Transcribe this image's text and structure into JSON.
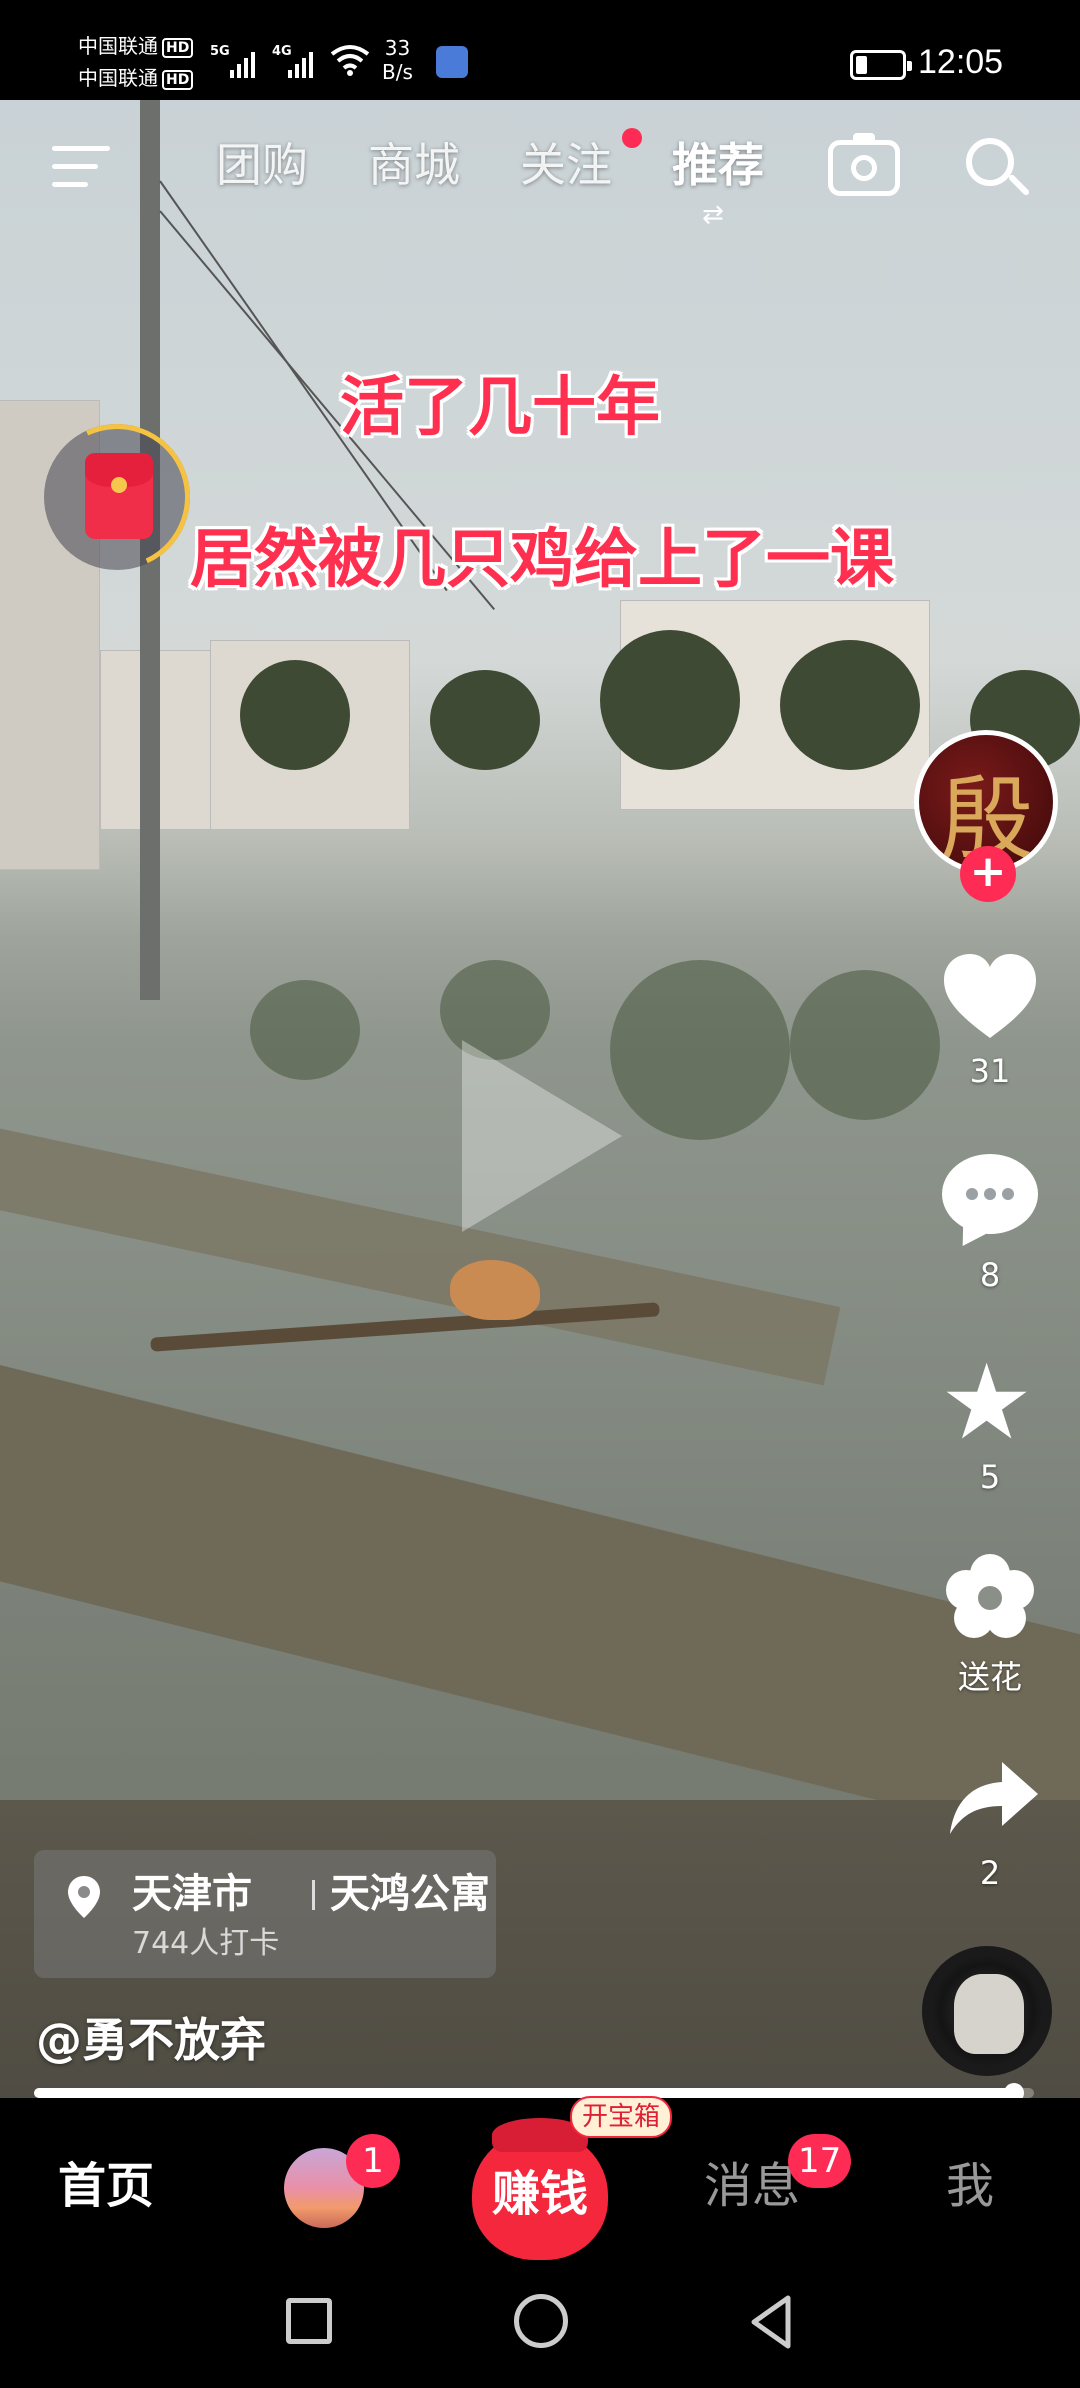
{
  "status_bar": {
    "carrier1": "中国联通",
    "carrier2": "中国联通",
    "hd": "HD",
    "net1": "5G",
    "net2": "4G",
    "speed_value": "33",
    "speed_unit": "B/s",
    "time": "12:05",
    "battery_level": 0.25
  },
  "top_nav": {
    "menu_icon": "menu-icon",
    "tabs": [
      "团购",
      "商城",
      "关注",
      "推荐"
    ],
    "active_tab": "推荐",
    "follow_has_dot": true,
    "camera_icon": "camera-icon",
    "search_icon": "search-icon"
  },
  "video": {
    "caption_line1": "活了几十年",
    "caption_line2": "居然被几只鸡给上了一课",
    "caption_color": "#ff2f4f"
  },
  "right_rail": {
    "avatar_char": "殷",
    "likes": "31",
    "comments": "8",
    "favorites": "5",
    "flower_label": "送花",
    "shares": "2"
  },
  "location": {
    "city": "天津市",
    "place": "天鸿公寓",
    "checkins": "744人打卡"
  },
  "author": "@勇不放弃",
  "progress": 0.98,
  "tab_bar": {
    "home": "首页",
    "friend_badge": "1",
    "earn": "赚钱",
    "earn_badge": "开宝箱",
    "messages": "消息",
    "messages_badge": "17",
    "me": "我"
  },
  "colors": {
    "accent": "#fe2c55",
    "earn_red": "#f5273d"
  }
}
